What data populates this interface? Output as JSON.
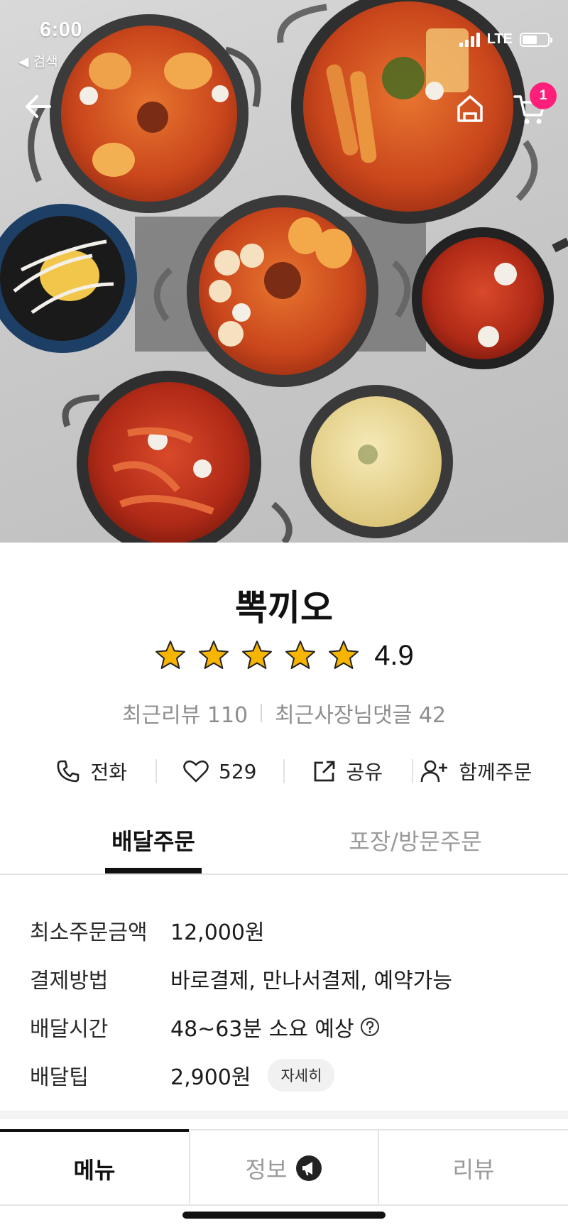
{
  "status_bar": {
    "time": "6:00",
    "back_app": "◀ 검색",
    "network": "LTE"
  },
  "header": {
    "cart_count": "1",
    "icons": [
      "back-arrow-icon",
      "home-icon",
      "cart-icon"
    ]
  },
  "store": {
    "name": "뽁끼오",
    "rating": "4.9",
    "stars": 5,
    "recent_reviews": "최근리뷰 110",
    "owner_replies": "최근사장님댓글 42"
  },
  "actions": [
    {
      "label": "전화",
      "icon": "phone-icon"
    },
    {
      "label": "529",
      "icon": "heart-icon"
    },
    {
      "label": "공유",
      "icon": "share-icon"
    },
    {
      "label": "함께주문",
      "icon": "add-person-icon"
    }
  ],
  "order_tabs": {
    "delivery": "배달주문",
    "pickup": "포장/방문주문",
    "selected": "delivery"
  },
  "info": {
    "min_order_label": "최소주문금액",
    "min_order_value": "12,000원",
    "payment_label": "결제방법",
    "payment_value": "바로결제, 만나서결제, 예약가능",
    "delivery_time_label": "배달시간",
    "delivery_time_value": "48~63분 소요 예상",
    "tip_label": "배달팁",
    "tip_value": "2,900원",
    "tip_detail": "자세히"
  },
  "bottom_tabs": {
    "menu": "메뉴",
    "info": "정보",
    "review": "리뷰",
    "selected": "menu"
  },
  "colors": {
    "badge": "#ff1f7a",
    "star": "#f7b500",
    "text_primary": "#111111",
    "text_muted": "#9a9a9a"
  }
}
